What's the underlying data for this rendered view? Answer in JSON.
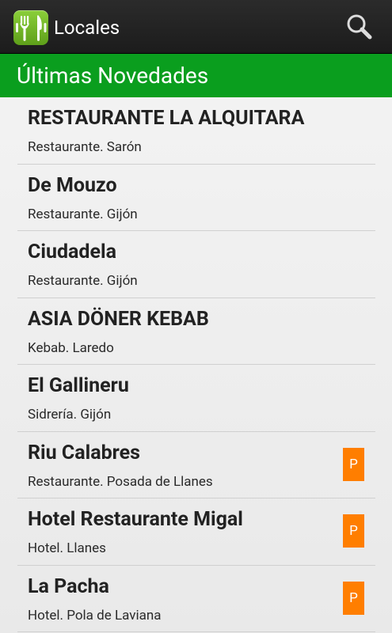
{
  "action_bar": {
    "title": "Locales",
    "app_icon": "fork-knife-icon",
    "search_icon": "search-icon"
  },
  "section": {
    "title": "Últimas Novedades"
  },
  "colors": {
    "action_bar": "#222222",
    "header_green": "#0a9e1e",
    "badge_orange": "#ff7e00"
  },
  "items": [
    {
      "name": "RESTAURANTE LA ALQUITARA",
      "subtitle": "Restaurante. Sarón",
      "badge": ""
    },
    {
      "name": "De Mouzo",
      "subtitle": "Restaurante. Gijón",
      "badge": ""
    },
    {
      "name": "Ciudadela",
      "subtitle": "Restaurante. Gijón",
      "badge": ""
    },
    {
      "name": "ASIA DÖNER KEBAB",
      "subtitle": "Kebab. Laredo",
      "badge": ""
    },
    {
      "name": "El Gallineru",
      "subtitle": "Sidrería. Gijón",
      "badge": ""
    },
    {
      "name": "Riu Calabres",
      "subtitle": "Restaurante. Posada de Llanes",
      "badge": "P"
    },
    {
      "name": "Hotel Restaurante Migal",
      "subtitle": "Hotel. Llanes",
      "badge": "P"
    },
    {
      "name": "La Pacha",
      "subtitle": "Hotel. Pola de Laviana",
      "badge": "P"
    }
  ]
}
